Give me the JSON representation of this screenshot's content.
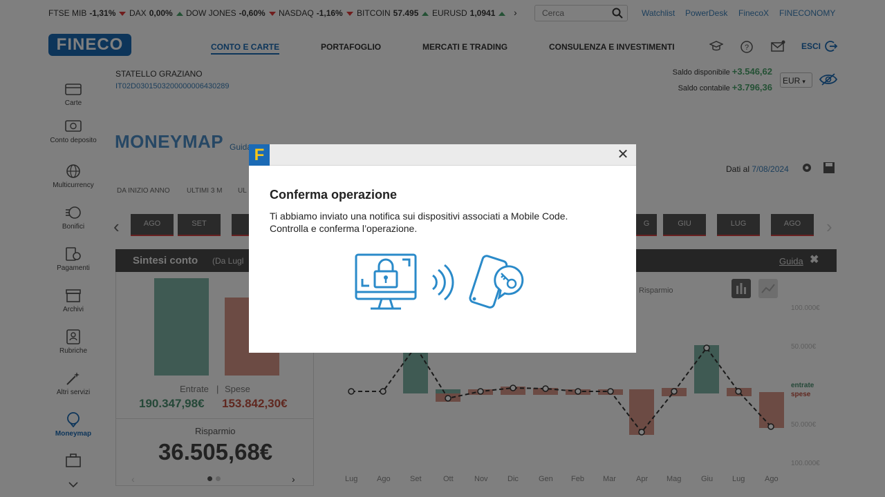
{
  "ticker": [
    {
      "name": "FTSE MIB",
      "value": "-1,31%",
      "dir": "down"
    },
    {
      "name": "DAX",
      "value": "0,00%",
      "dir": "up"
    },
    {
      "name": "DOW JONES",
      "value": "-0,60%",
      "dir": "down"
    },
    {
      "name": "NASDAQ",
      "value": "-1,16%",
      "dir": "down"
    },
    {
      "name": "BITCOIN",
      "value": "57.495",
      "dir": "up"
    },
    {
      "name": "EURUSD",
      "value": "1,0941",
      "dir": "up"
    }
  ],
  "search": {
    "placeholder": "Cerca"
  },
  "toplinks": [
    "Watchlist",
    "PowerDesk",
    "FinecoX",
    "FINECONOMY"
  ],
  "brand": {
    "logo": "FINECO",
    "accent": "#1b6ab5"
  },
  "nav": [
    "CONTO E CARTE",
    "PORTAFOGLIO",
    "MERCATI E TRADING",
    "CONSULENZA E INVESTIMENTI"
  ],
  "logout": "ESCI",
  "sidebar": [
    {
      "label": "Carte",
      "icon": "card-icon"
    },
    {
      "label": "Conto deposito",
      "icon": "deposit-icon"
    },
    {
      "label": "Multicurrency",
      "icon": "globe-icon"
    },
    {
      "label": "Bonifici",
      "icon": "transfer-icon"
    },
    {
      "label": "Pagamenti",
      "icon": "payment-icon"
    },
    {
      "label": "Archivi",
      "icon": "archive-icon"
    },
    {
      "label": "Rubriche",
      "icon": "contacts-icon"
    },
    {
      "label": "Altri servizi",
      "icon": "magic-icon"
    },
    {
      "label": "Moneymap",
      "icon": "moneymap-icon"
    }
  ],
  "account": {
    "holder": "STATELLO GRAZIANO",
    "iban": "IT02D0301503200000006430289",
    "saldo_disp_label": "Saldo disponibile",
    "saldo_disp": "+3.546,62",
    "saldo_cont_label": "Saldo contabile",
    "saldo_cont": "+3.796,36",
    "currency": "EUR"
  },
  "moneymap": {
    "logo": "MONEYMAP",
    "guida": "Guida",
    "dati_label": "Dati al",
    "dati_date": "7/08/2024",
    "periods": [
      "DA INIZIO ANNO",
      "ULTIMI 3 M",
      "UL"
    ],
    "months_left": [
      "AGO",
      "SET"
    ],
    "months_right": [
      "G",
      "GIU",
      "LUG",
      "AGO"
    ],
    "sintesi_title": "Sintesi conto",
    "sintesi_sub": "(Da Lugl",
    "entrate_label": "Entrate",
    "spese_label": "Spese",
    "entrate": "190.347,98€",
    "spese": "153.842,30€",
    "risparmio_label": "Risparmio",
    "risparmio": "36.505,68€",
    "legend_risparmio": "Risparmio",
    "legend_entrate": "entrate",
    "legend_spese": "spese",
    "y_ticks": [
      "100.000€",
      "50.000€",
      "50.000€",
      "100.000€"
    ],
    "x_labels": [
      "Lug",
      "Ago",
      "Set",
      "Ott",
      "Nov",
      "Dic",
      "Gen",
      "Feb",
      "Mar",
      "Apr",
      "Mag",
      "Giu",
      "Lug",
      "Ago"
    ]
  },
  "modal": {
    "badge": "F",
    "title": "Conferma operazione",
    "line1": "Ti abbiamo inviato una notifica sui dispositivi associati a Mobile Code.",
    "line2": "Controlla e conferma l’operazione."
  }
}
